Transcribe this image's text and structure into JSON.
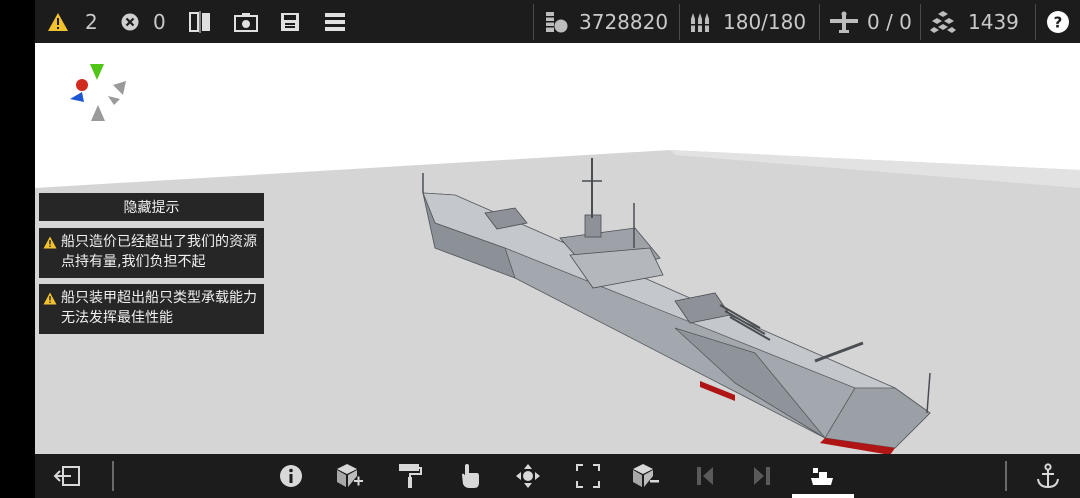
{
  "topbar": {
    "warnings": "2",
    "errors": "0",
    "resources": "3728820",
    "ammo": "180/180",
    "aircraft": "0 / 0",
    "parts": "1439"
  },
  "hints": {
    "hide_label": "隐藏提示",
    "items": [
      "船只造价已经超出了我们的资源点持有量,我们负担不起",
      "船只装甲超出船只类型承载能力无法发挥最佳性能"
    ]
  },
  "colors": {
    "bar_bg": "#1c1c1c",
    "warning": "#f2c12e",
    "hull": "#aeb3ba",
    "waterline": "#b01515"
  }
}
